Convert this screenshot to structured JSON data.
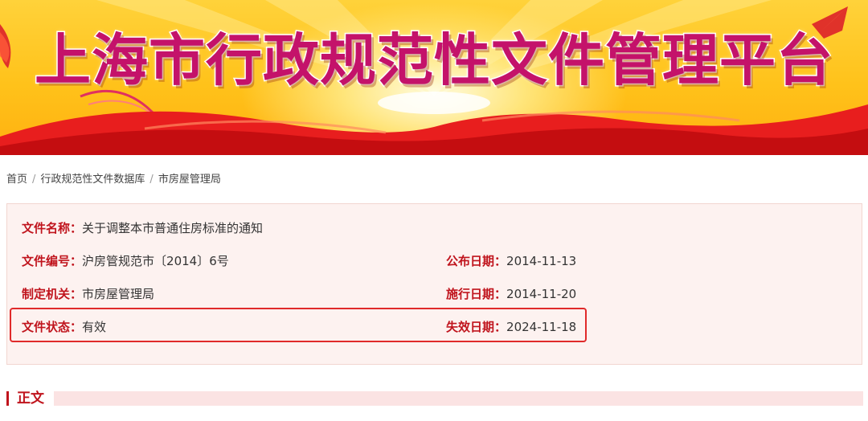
{
  "banner": {
    "title": "上海市行政规范性文件管理平台"
  },
  "breadcrumb": {
    "home": "首页",
    "database": "行政规范性文件数据库",
    "current": "市房屋管理局",
    "separator": "/"
  },
  "document": {
    "name_label": "文件名称",
    "name_value": "关于调整本市普通住房标准的通知",
    "number_label": "文件编号",
    "number_value": "沪房管规范市〔2014〕6号",
    "publish_label": "公布日期",
    "publish_value": "2014-11-13",
    "agency_label": "制定机关",
    "agency_value": "市房屋管理局",
    "effective_label": "施行日期",
    "effective_value": "2014-11-20",
    "status_label": "文件状态",
    "status_value": "有效",
    "expiry_label": "失效日期",
    "expiry_value": "2024-11-18",
    "colon": "："
  },
  "section": {
    "title": "正文"
  },
  "colors": {
    "accent_red": "#c0141d",
    "panel_bg": "#fdf2f0",
    "highlight_border": "#e02a2a",
    "banner_gold": "#ffc21a"
  }
}
